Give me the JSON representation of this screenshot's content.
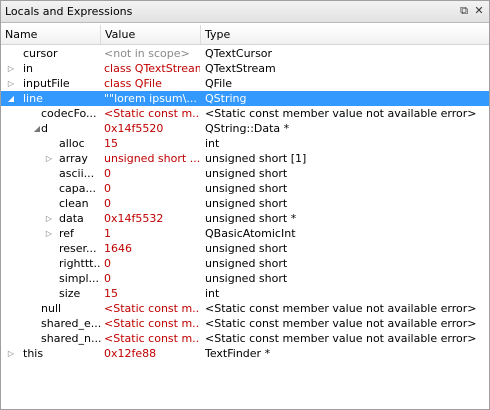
{
  "window": {
    "title": "Locals and Expressions",
    "float_icon": "float-icon",
    "close_icon": "close-icon"
  },
  "columns": {
    "name": "Name",
    "value": "Value",
    "type": "Type"
  },
  "rows": [
    {
      "name": "cursor",
      "value": "<not in scope>",
      "type": "QTextCursor",
      "expander": "none",
      "depth": 0,
      "grey": true
    },
    {
      "name": "in",
      "value": "class QTextStream",
      "type": "QTextStream",
      "expander": "collapsed",
      "depth": 0
    },
    {
      "name": "inputFile",
      "value": "class QFile",
      "type": "QFile",
      "expander": "collapsed",
      "depth": 0
    },
    {
      "name": "line",
      "value": "\"\"lorem ipsum\\...",
      "type": "QString",
      "expander": "expanded",
      "depth": 0,
      "selected": true
    },
    {
      "name": "codecFo...",
      "value": "<Static const m...",
      "type": "<Static const member value not available error>",
      "expander": "none",
      "depth": 1
    },
    {
      "name": "d",
      "value": "0x14f5520",
      "type": "QString::Data *",
      "expander": "expanded",
      "depth": 1
    },
    {
      "name": "alloc",
      "value": "15",
      "type": "int",
      "expander": "none",
      "depth": 2
    },
    {
      "name": "array",
      "value": "unsigned short ...",
      "type": "unsigned short [1]",
      "expander": "collapsed",
      "depth": 2
    },
    {
      "name": "ascii...",
      "value": "0",
      "type": "unsigned short",
      "expander": "none",
      "depth": 2
    },
    {
      "name": "capa...",
      "value": "0",
      "type": "unsigned short",
      "expander": "none",
      "depth": 2
    },
    {
      "name": "clean",
      "value": "0",
      "type": "unsigned short",
      "expander": "none",
      "depth": 2
    },
    {
      "name": "data",
      "value": "0x14f5532",
      "type": "unsigned short *",
      "expander": "collapsed",
      "depth": 2
    },
    {
      "name": "ref",
      "value": "1",
      "type": "QBasicAtomicInt",
      "expander": "collapsed",
      "depth": 2
    },
    {
      "name": "reser...",
      "value": "1646",
      "type": "unsigned short",
      "expander": "none",
      "depth": 2
    },
    {
      "name": "righttt...",
      "value": "0",
      "type": "unsigned short",
      "expander": "none",
      "depth": 2
    },
    {
      "name": "simpl...",
      "value": "0",
      "type": "unsigned short",
      "expander": "none",
      "depth": 2
    },
    {
      "name": "size",
      "value": "15",
      "type": "int",
      "expander": "none",
      "depth": 2
    },
    {
      "name": "null",
      "value": "<Static const m...",
      "type": "<Static const member value not available error>",
      "expander": "none",
      "depth": 1
    },
    {
      "name": "shared_e...",
      "value": "<Static const m...",
      "type": "<Static const member value not available error>",
      "expander": "none",
      "depth": 1
    },
    {
      "name": "shared_n...",
      "value": "<Static const m...",
      "type": "<Static const member value not available error>",
      "expander": "none",
      "depth": 1
    },
    {
      "name": "this",
      "value": "0x12fe88",
      "type": "TextFinder *",
      "expander": "collapsed",
      "depth": 0
    }
  ]
}
